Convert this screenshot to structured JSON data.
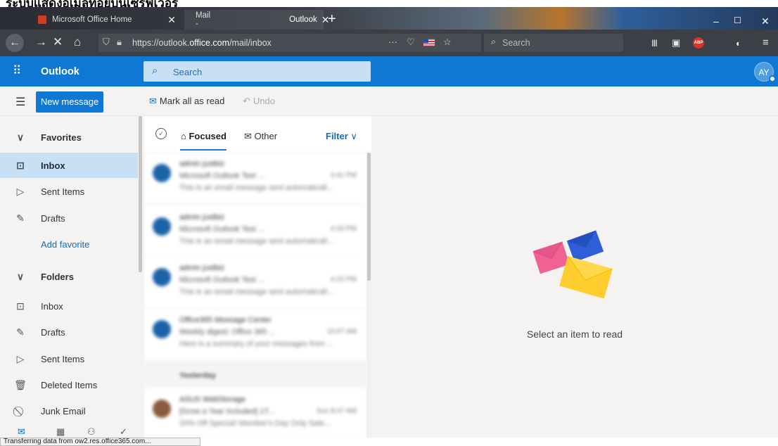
{
  "caption": "ระบบแสดงอีเมลที่อยู่บนเซิร์ฟเวอร์",
  "browser": {
    "tabs": [
      {
        "title": "Microsoft Office Home"
      },
      {
        "title_a": "Mail -",
        "title_b": "Outlook"
      }
    ],
    "url_prefix": "https://outlook.",
    "url_domain": "office.com",
    "url_path": "/mail/inbox",
    "search_placeholder": "Search",
    "page_actions": "···",
    "abp_label": "ABP"
  },
  "outlook": {
    "app_name": "Outlook",
    "search_placeholder": "Search",
    "avatar_initials": "AY",
    "new_message_label": "New message",
    "mark_all_read_label": "Mark all as read",
    "undo_label": "Undo"
  },
  "nav": {
    "favorites_header": "Favorites",
    "favorites": [
      "Inbox",
      "Sent Items",
      "Drafts"
    ],
    "add_favorite": "Add favorite",
    "folders_header": "Folders",
    "folders": [
      "Inbox",
      "Drafts",
      "Sent Items",
      "Deleted Items",
      "Junk Email"
    ]
  },
  "list": {
    "tabs": [
      "Focused",
      "Other"
    ],
    "filter_label": "Filter",
    "messages": [
      {
        "sender": "admin justbiz",
        "subject": "Microsoft Outlook Test ...",
        "preview": "This is an email message sent automaticall...",
        "time": "4:41 PM"
      },
      {
        "sender": "admin justbiz",
        "subject": "Microsoft Outlook Test ...",
        "preview": "This is an email message sent automaticall...",
        "time": "4:33 PM"
      },
      {
        "sender": "admin justbiz",
        "subject": "Microsoft Outlook Test ...",
        "preview": "This is an email message sent automaticall...",
        "time": "4:22 PM"
      },
      {
        "sender": "Office365 Message Center",
        "subject": "Weekly digest: Office 365 ...",
        "preview": "Here is a summary of your messages from ...",
        "time": "10:07 AM"
      }
    ],
    "day_separator": "Yesterday",
    "older_message": {
      "sender": "ASUS WebStorage",
      "subject": "[Grow a Year Included] 1T...",
      "preview": "20% Off Special! Member's Day Only Sale...",
      "time": "Sun 8:47 AM"
    }
  },
  "reading_pane": {
    "empty_text": "Select an item to read"
  },
  "status": "Transferring data from ow2.res.office365.com..."
}
